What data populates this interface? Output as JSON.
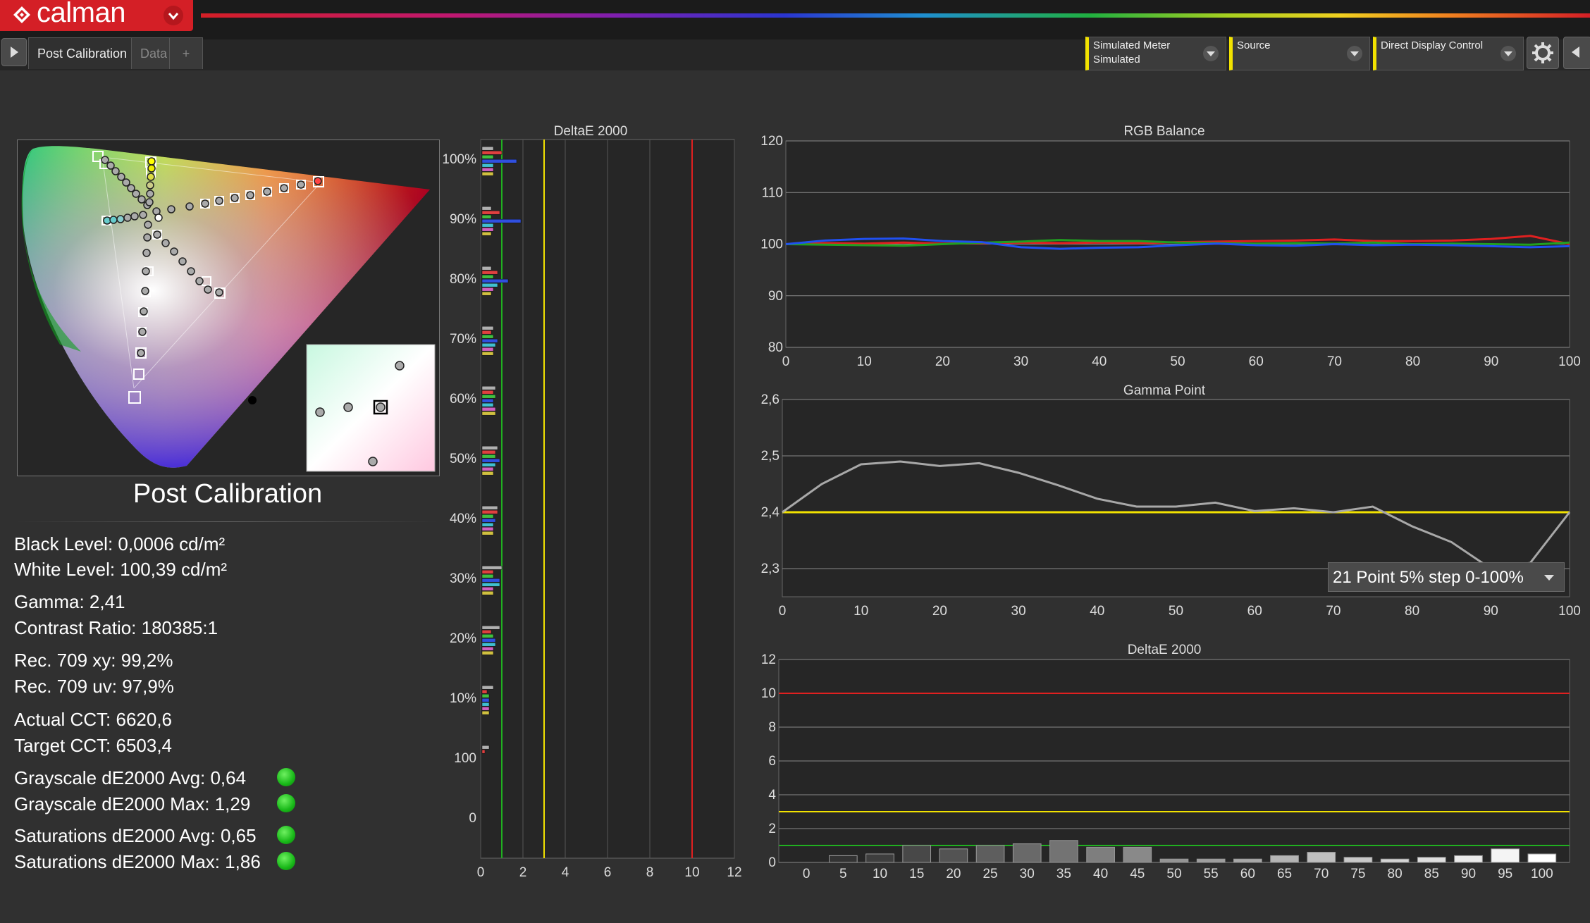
{
  "app": {
    "name": "calman"
  },
  "tabs": [
    {
      "label": "Post Calibration",
      "active": true
    },
    {
      "label": "Data",
      "active": false
    },
    {
      "label": "+",
      "active": false
    }
  ],
  "dropdowns": {
    "meter": {
      "line1": "Simulated Meter",
      "line2": "Simulated"
    },
    "source": {
      "line1": "Source",
      "line2": ""
    },
    "display": {
      "line1": "Direct Display Control",
      "line2": ""
    }
  },
  "page_title": "Post Calibration",
  "stats": {
    "black_level": "Black Level: 0,0006 cd/m²",
    "white_level": "White Level: 100,39 cd/m²",
    "gamma": "Gamma: 2,41",
    "contrast": "Contrast Ratio: 180385:1",
    "rec709_xy": "Rec. 709 xy: 99,2%",
    "rec709_uv": "Rec. 709 uv: 97,9%",
    "actual_cct": "Actual CCT: 6620,6",
    "target_cct": "Target CCT: 6503,4",
    "gs_avg": "Grayscale dE2000 Avg: 0,64",
    "gs_max": "Grayscale dE2000 Max: 1,29",
    "sat_avg": "Saturations dE2000 Avg: 0,65",
    "sat_max": "Saturations dE2000 Max: 1,86",
    "status_color": "#18b818"
  },
  "gamma_preset": "21 Point 5% step 0-100%",
  "colors": {
    "accent": "#d41f26",
    "red_threshold": "#e02020",
    "yellow_threshold": "#f2e200",
    "green_threshold": "#20b020",
    "red": "#e02020",
    "green": "#20a020",
    "blue": "#2050f0",
    "gamma_line": "#a8a8a8"
  },
  "chart_data": [
    {
      "type": "bar",
      "title": "DeltaE 2000",
      "orientation": "horizontal",
      "categories": [
        "100%",
        "90%",
        "80%",
        "70%",
        "60%",
        "50%",
        "40%",
        "30%",
        "20%",
        "10%",
        "100",
        "0"
      ],
      "xlim": [
        0,
        12
      ],
      "xticks": [
        "0",
        "2",
        "4",
        "6",
        "8",
        "10",
        "12"
      ],
      "thresholds": [
        1,
        3,
        10
      ],
      "series": [
        {
          "name": "grayscale",
          "color": "#b0b0b0",
          "values": [
            0.6,
            0.5,
            0.5,
            0.6,
            0.7,
            0.8,
            0.8,
            1.0,
            0.9,
            0.6,
            0.4,
            0.0
          ]
        },
        {
          "name": "red",
          "color": "#e04040",
          "values": [
            1.0,
            0.9,
            0.8,
            0.5,
            0.6,
            0.7,
            0.8,
            0.6,
            0.5,
            0.3,
            0.2,
            0.0
          ]
        },
        {
          "name": "green",
          "color": "#40c040",
          "values": [
            0.6,
            0.5,
            0.6,
            0.6,
            0.7,
            0.7,
            0.6,
            0.6,
            0.6,
            0.4,
            0.0,
            0.0
          ]
        },
        {
          "name": "blue",
          "color": "#3050e0",
          "values": [
            1.7,
            1.9,
            1.3,
            0.8,
            0.6,
            0.9,
            0.7,
            0.9,
            0.7,
            0.4,
            0.0,
            0.0
          ]
        },
        {
          "name": "cyan",
          "color": "#40c0d0",
          "values": [
            0.6,
            0.6,
            0.8,
            0.7,
            0.6,
            0.7,
            0.6,
            0.9,
            0.7,
            0.4,
            0.0,
            0.0
          ]
        },
        {
          "name": "magenta",
          "color": "#d060c0",
          "values": [
            0.6,
            0.6,
            0.6,
            0.6,
            0.7,
            0.6,
            0.6,
            0.6,
            0.6,
            0.4,
            0.0,
            0.0
          ]
        },
        {
          "name": "yellow",
          "color": "#d0c040",
          "values": [
            0.6,
            0.5,
            0.5,
            0.6,
            0.7,
            0.6,
            0.6,
            0.6,
            0.6,
            0.4,
            0.0,
            0.0
          ]
        }
      ]
    },
    {
      "type": "line",
      "title": "RGB Balance",
      "x": [
        0,
        5,
        10,
        15,
        20,
        25,
        30,
        35,
        40,
        45,
        50,
        55,
        60,
        65,
        70,
        75,
        80,
        85,
        90,
        95,
        100
      ],
      "ylim": [
        80,
        120
      ],
      "yticks": [
        "80",
        "90",
        "100",
        "110",
        "120"
      ],
      "xticks": [
        "0",
        "10",
        "20",
        "30",
        "40",
        "50",
        "60",
        "70",
        "80",
        "90",
        "100"
      ],
      "series": [
        {
          "name": "red",
          "color": "#e02020",
          "values": [
            100,
            100.2,
            100.1,
            100.3,
            100.1,
            100.2,
            100.3,
            100.2,
            100.3,
            100.2,
            100.4,
            100.5,
            100.6,
            100.7,
            100.9,
            100.6,
            100.6,
            100.7,
            101,
            101.6,
            100
          ]
        },
        {
          "name": "green",
          "color": "#20a020",
          "values": [
            100,
            99.9,
            99.8,
            99.7,
            100,
            100.3,
            100.5,
            100.8,
            100.6,
            100.6,
            100.3,
            100.2,
            100.1,
            100.2,
            100.1,
            100.3,
            100,
            100.1,
            100,
            99.9,
            100.3
          ]
        },
        {
          "name": "blue",
          "color": "#2050f0",
          "values": [
            100,
            100.7,
            101.0,
            101.1,
            100.6,
            100.4,
            99.4,
            99.1,
            99.3,
            99.4,
            99.8,
            100.1,
            99.8,
            99.7,
            100.0,
            99.8,
            99.9,
            99.8,
            99.6,
            99.4,
            99.6
          ]
        }
      ]
    },
    {
      "type": "line",
      "title": "Gamma Point",
      "x": [
        0,
        5,
        10,
        15,
        20,
        25,
        30,
        35,
        40,
        45,
        50,
        55,
        60,
        65,
        70,
        75,
        80,
        85,
        90,
        95,
        100
      ],
      "ylim": [
        2.25,
        2.6
      ],
      "yticks": [
        "2,3",
        "2,4",
        "2,5",
        "2,6"
      ],
      "xticks": [
        "0",
        "10",
        "20",
        "30",
        "40",
        "50",
        "60",
        "70",
        "80",
        "90",
        "100"
      ],
      "target": 2.4,
      "series": [
        {
          "name": "gamma",
          "color": "#a8a8a8",
          "values": [
            2.4,
            2.45,
            2.485,
            2.49,
            2.482,
            2.487,
            2.47,
            2.448,
            2.424,
            2.41,
            2.41,
            2.417,
            2.402,
            2.407,
            2.4,
            2.41,
            2.375,
            2.347,
            2.3,
            2.31,
            2.4
          ]
        }
      ]
    },
    {
      "type": "bar",
      "title": "DeltaE 2000",
      "categories": [
        "0",
        "5",
        "10",
        "15",
        "20",
        "25",
        "30",
        "35",
        "40",
        "45",
        "50",
        "55",
        "60",
        "65",
        "70",
        "75",
        "80",
        "85",
        "90",
        "95",
        "100"
      ],
      "values": [
        0.0,
        0.4,
        0.5,
        1.0,
        0.8,
        1.0,
        1.1,
        1.3,
        0.9,
        0.9,
        0.2,
        0.2,
        0.2,
        0.4,
        0.6,
        0.3,
        0.2,
        0.3,
        0.4,
        0.8,
        0.5
      ],
      "ylim": [
        0,
        12
      ],
      "yticks": [
        "0",
        "2",
        "4",
        "6",
        "8",
        "10",
        "12"
      ],
      "thresholds": [
        1,
        3,
        10
      ]
    }
  ]
}
